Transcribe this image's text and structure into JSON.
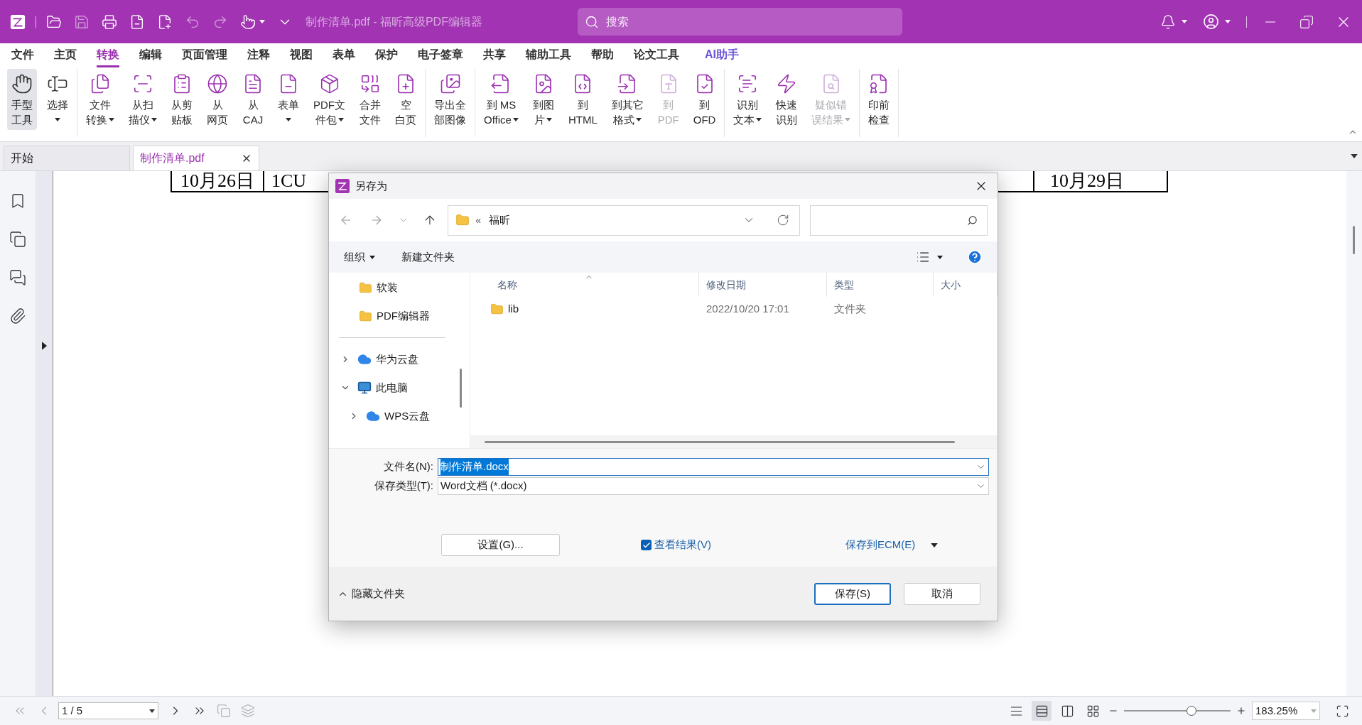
{
  "title_bar": {
    "title": "制作清单.pdf - 福昕高级PDF编辑器",
    "search": {
      "placeholder": "搜索"
    }
  },
  "menu_tabs": [
    {
      "label": "文件",
      "selected": false,
      "kind": "plain"
    },
    {
      "label": "主页",
      "selected": false,
      "kind": "plain"
    },
    {
      "label": "转换",
      "selected": true,
      "kind": "plain"
    },
    {
      "label": "编辑",
      "selected": false,
      "kind": "plain"
    },
    {
      "label": "页面管理",
      "selected": false,
      "kind": "plain"
    },
    {
      "label": "注释",
      "selected": false,
      "kind": "plain"
    },
    {
      "label": "视图",
      "selected": false,
      "kind": "plain"
    },
    {
      "label": "表单",
      "selected": false,
      "kind": "plain"
    },
    {
      "label": "保护",
      "selected": false,
      "kind": "plain"
    },
    {
      "label": "电子签章",
      "selected": false,
      "kind": "plain"
    },
    {
      "label": "共享",
      "selected": false,
      "kind": "plain"
    },
    {
      "label": "辅助工具",
      "selected": false,
      "kind": "plain"
    },
    {
      "label": "帮助",
      "selected": false,
      "kind": "plain"
    },
    {
      "label": "论文工具",
      "selected": false,
      "kind": "plain"
    },
    {
      "label": "AI助手",
      "selected": false,
      "kind": "ai"
    }
  ],
  "ribbon": {
    "groups": [
      {
        "items": [
          {
            "lines": [
              "手型",
              "工具"
            ],
            "dropdown": false,
            "disabled": false,
            "selected": true
          },
          {
            "lines": [
              "选择"
            ],
            "dropdown": true,
            "disabled": false,
            "selected": false
          }
        ]
      },
      {
        "items": [
          {
            "lines": [
              "文件",
              "转换"
            ],
            "dropdown": true,
            "disabled": false,
            "selected": false
          },
          {
            "lines": [
              "从扫",
              "描仪"
            ],
            "dropdown": true,
            "disabled": false,
            "selected": false
          },
          {
            "lines": [
              "从剪",
              "贴板"
            ],
            "dropdown": false,
            "disabled": false,
            "selected": false
          },
          {
            "lines": [
              "从",
              "网页"
            ],
            "dropdown": false,
            "disabled": false,
            "selected": false
          },
          {
            "lines": [
              "从",
              "CAJ"
            ],
            "dropdown": false,
            "disabled": false,
            "selected": false
          },
          {
            "lines": [
              "表单"
            ],
            "dropdown": true,
            "disabled": false,
            "selected": false
          },
          {
            "lines": [
              "PDF文",
              "件包"
            ],
            "dropdown": true,
            "disabled": false,
            "selected": false
          },
          {
            "lines": [
              "合并",
              "文件"
            ],
            "dropdown": false,
            "disabled": false,
            "selected": false
          },
          {
            "lines": [
              "空",
              "白页"
            ],
            "dropdown": false,
            "disabled": false,
            "selected": false
          }
        ]
      },
      {
        "items": [
          {
            "lines": [
              "导出全",
              "部图像"
            ],
            "dropdown": false,
            "disabled": false,
            "selected": false
          }
        ]
      },
      {
        "items": [
          {
            "lines": [
              "到 MS",
              "Office"
            ],
            "dropdown": true,
            "disabled": false,
            "selected": false
          },
          {
            "lines": [
              "到图",
              "片"
            ],
            "dropdown": true,
            "disabled": false,
            "selected": false
          },
          {
            "lines": [
              "到",
              "HTML"
            ],
            "dropdown": false,
            "disabled": false,
            "selected": false
          },
          {
            "lines": [
              "到其它",
              "格式"
            ],
            "dropdown": true,
            "disabled": false,
            "selected": false
          },
          {
            "lines": [
              "到",
              "PDF"
            ],
            "dropdown": false,
            "disabled": true,
            "selected": false
          },
          {
            "lines": [
              "到",
              "OFD"
            ],
            "dropdown": false,
            "disabled": false,
            "selected": false
          }
        ]
      },
      {
        "items": [
          {
            "lines": [
              "识别",
              "文本"
            ],
            "dropdown": true,
            "disabled": false,
            "selected": false
          },
          {
            "lines": [
              "快速",
              "识别"
            ],
            "dropdown": false,
            "disabled": false,
            "selected": false
          },
          {
            "lines": [
              "疑似错",
              "误结果"
            ],
            "dropdown": true,
            "disabled": true,
            "selected": false
          }
        ]
      },
      {
        "items": [
          {
            "lines": [
              "印前",
              "检查"
            ],
            "dropdown": false,
            "disabled": false,
            "selected": false
          }
        ]
      }
    ]
  },
  "doc_tabs": [
    {
      "label": "开始",
      "selected": false,
      "closable": false
    },
    {
      "label": "制作清单.pdf",
      "selected": true,
      "closable": true
    }
  ],
  "page": {
    "cells": [
      "10月26日",
      "1CU",
      "10月29日"
    ]
  },
  "dialog": {
    "title": "另存为",
    "address": {
      "prefix": "«",
      "path": "福昕"
    },
    "toolbar": {
      "organize": "组织",
      "new_folder": "新建文件夹"
    },
    "quick_access": [
      {
        "label": "软装"
      },
      {
        "label": "PDF编辑器"
      }
    ],
    "locations": [
      {
        "label": "华为云盘",
        "kind": "cloud",
        "expanded": false
      },
      {
        "label": "此电脑",
        "kind": "pc",
        "expanded": true,
        "children": [
          {
            "label": "WPS云盘",
            "kind": "cloud",
            "expanded": false
          }
        ]
      }
    ],
    "columns": [
      {
        "label": "名称",
        "sorted": true
      },
      {
        "label": "修改日期",
        "sorted": false
      },
      {
        "label": "类型",
        "sorted": false
      },
      {
        "label": "大小",
        "sorted": false
      }
    ],
    "rows": [
      {
        "name": "lib",
        "modified": "2022/10/20 17:01",
        "type": "文件夹"
      }
    ],
    "fields": [
      {
        "label": "文件名(N):",
        "value": "制作清单.docx",
        "highlighted": true
      },
      {
        "label": "保存类型(T):",
        "value": "Word文档 (*.docx)",
        "highlighted": false
      }
    ],
    "settings_button": "设置(G)...",
    "view_result": {
      "label": "查看结果(V)",
      "checked": true
    },
    "save_to_ecm": "保存到ECM(E)",
    "hide_folders": "隐藏文件夹",
    "buttons": [
      {
        "label": "保存(S)",
        "default": true
      },
      {
        "label": "取消",
        "default": false
      }
    ]
  },
  "status_bar": {
    "page_field": "1 / 5",
    "view_modes": [
      {
        "selected": false
      },
      {
        "selected": true
      },
      {
        "selected": false
      },
      {
        "selected": false
      }
    ],
    "zoom": {
      "level": 0.63,
      "value": "183.25%"
    }
  }
}
